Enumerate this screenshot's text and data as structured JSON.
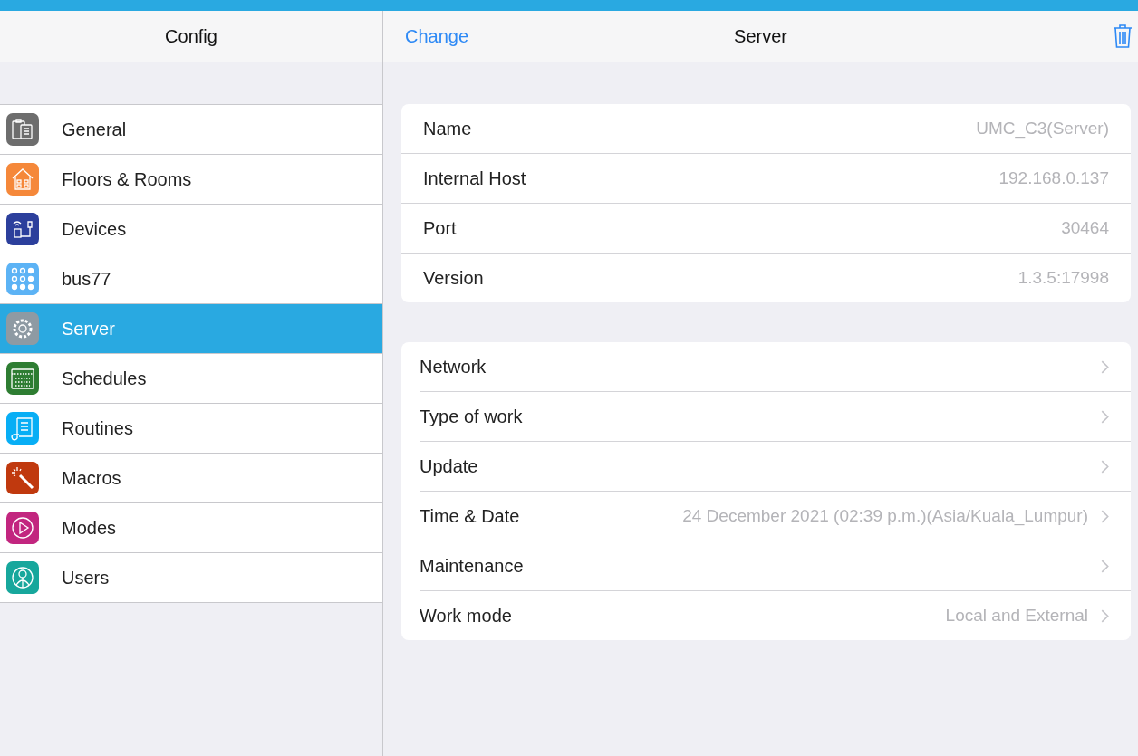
{
  "sidebar": {
    "title": "Config",
    "items": [
      {
        "label": "General",
        "kind": "clipboard",
        "color": "#6d6d6d",
        "selected": false
      },
      {
        "label": "Floors & Rooms",
        "kind": "house",
        "color": "#f5883a",
        "selected": false
      },
      {
        "label": "Devices",
        "kind": "device",
        "color": "#2c3f9c",
        "selected": false
      },
      {
        "label": "bus77",
        "kind": "keypad",
        "color": "#5cb3f5",
        "selected": false
      },
      {
        "label": "Server",
        "kind": "gear",
        "color": "#8e9aa3",
        "selected": true
      },
      {
        "label": "Schedules",
        "kind": "calendar",
        "color": "#2e7d32",
        "selected": false
      },
      {
        "label": "Routines",
        "kind": "scroll",
        "color": "#08aef5",
        "selected": false
      },
      {
        "label": "Macros",
        "kind": "wand",
        "color": "#c0390e",
        "selected": false
      },
      {
        "label": "Modes",
        "kind": "play",
        "color": "#c2267f",
        "selected": false
      },
      {
        "label": "Users",
        "kind": "person",
        "color": "#17a79c",
        "selected": false
      }
    ]
  },
  "detail": {
    "action": "Change",
    "title": "Server",
    "info": [
      {
        "label": "Name",
        "value": "UMC_C3(Server)"
      },
      {
        "label": "Internal Host",
        "value": "192.168.0.137"
      },
      {
        "label": "Port",
        "value": "30464"
      },
      {
        "label": "Version",
        "value": "1.3.5:17998"
      }
    ],
    "menu": [
      {
        "label": "Network"
      },
      {
        "label": "Type of work"
      },
      {
        "label": "Update"
      },
      {
        "label": "Time & Date",
        "value": "24 December 2021 (02:39 p.m.)(Asia/Kuala_Lumpur)"
      },
      {
        "label": "Maintenance"
      },
      {
        "label": "Work mode",
        "value": "Local and External"
      }
    ]
  }
}
